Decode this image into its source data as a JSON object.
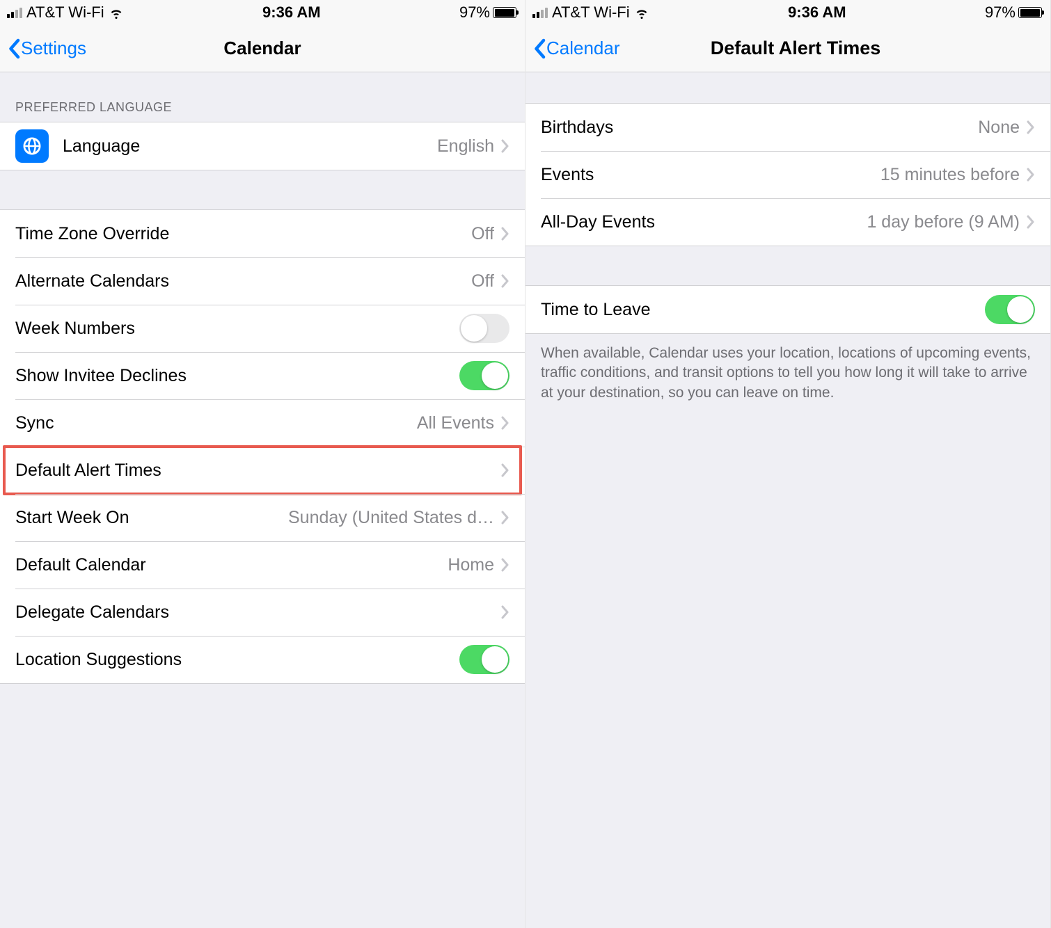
{
  "status": {
    "carrier": "AT&T Wi-Fi",
    "time": "9:36 AM",
    "battery_pct": "97%",
    "battery_fill_pct": 97
  },
  "left": {
    "back_label": "Settings",
    "title": "Calendar",
    "section_lang": "PREFERRED LANGUAGE",
    "language": {
      "label": "Language",
      "value": "English"
    },
    "time_zone": {
      "label": "Time Zone Override",
      "value": "Off"
    },
    "alternate": {
      "label": "Alternate Calendars",
      "value": "Off"
    },
    "week_numbers": {
      "label": "Week Numbers",
      "on": false
    },
    "invitee_declines": {
      "label": "Show Invitee Declines",
      "on": true
    },
    "sync": {
      "label": "Sync",
      "value": "All Events"
    },
    "default_alert": {
      "label": "Default Alert Times"
    },
    "start_week": {
      "label": "Start Week On",
      "value": "Sunday (United States d…"
    },
    "default_calendar": {
      "label": "Default Calendar",
      "value": "Home"
    },
    "delegate": {
      "label": "Delegate Calendars"
    },
    "location_suggestions": {
      "label": "Location Suggestions",
      "on": true
    }
  },
  "right": {
    "back_label": "Calendar",
    "title": "Default Alert Times",
    "birthdays": {
      "label": "Birthdays",
      "value": "None"
    },
    "events": {
      "label": "Events",
      "value": "15 minutes before"
    },
    "all_day": {
      "label": "All-Day Events",
      "value": "1 day before (9 AM)"
    },
    "time_to_leave": {
      "label": "Time to Leave",
      "on": true
    },
    "footer": "When available, Calendar uses your location, locations of upcoming events, traffic conditions, and transit options to tell you how long it will take to arrive at your destination, so you can leave on time."
  }
}
